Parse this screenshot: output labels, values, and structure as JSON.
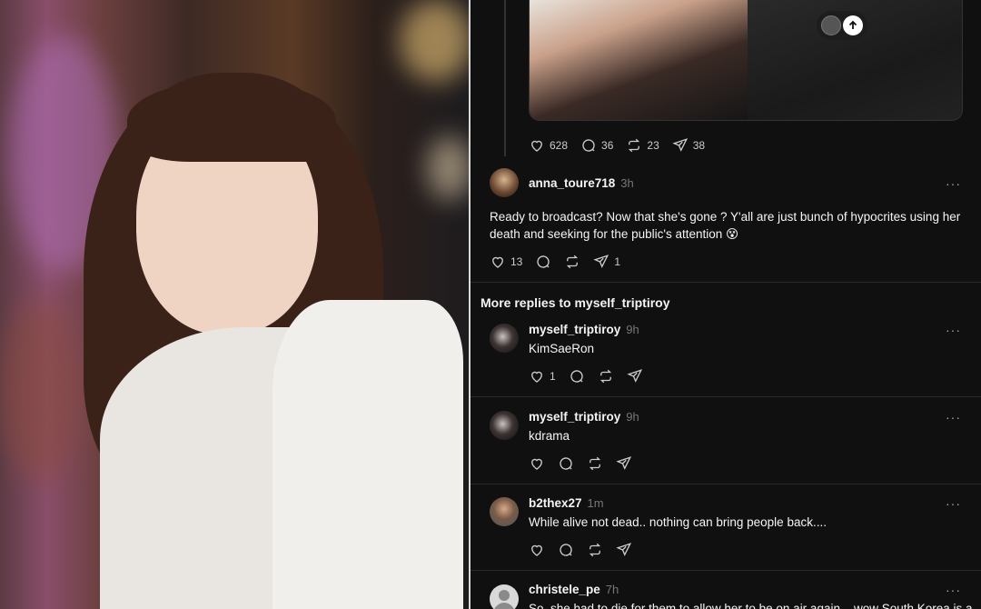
{
  "top_post_actions": {
    "likes": "628",
    "replies": "36",
    "reposts": "23",
    "shares": "38"
  },
  "reply1": {
    "username": "anna_toure718",
    "time": "3h",
    "text": "Ready to broadcast? Now that she's gone ? Y'all are just bunch of hypocrites using her death and seeking for the public's attention 😵",
    "likes": "13",
    "shares": "1"
  },
  "more_replies_header": "More replies to myself_triptiroy",
  "replies": [
    {
      "username": "myself_triptiroy",
      "time": "9h",
      "text": "KimSaeRon",
      "likes": "1"
    },
    {
      "username": "myself_triptiroy",
      "time": "9h",
      "text": "kdrama",
      "likes": ""
    },
    {
      "username": "b2thex27",
      "time": "1m",
      "text": "While alive not dead.. nothing can bring people back....",
      "likes": ""
    },
    {
      "username": "christele_pe",
      "time": "7h",
      "text": "So, she had to die for them to allow her to be on air again... wow South Korea is a",
      "likes": ""
    }
  ],
  "more_label": "···",
  "colors": {
    "background": "#101010",
    "text": "#f3f5f7",
    "muted": "#777777",
    "divider": "#2a2a2a"
  },
  "icons": [
    "heart-icon",
    "comment-icon",
    "repost-icon",
    "share-icon",
    "more-icon",
    "arrow-up-icon"
  ]
}
